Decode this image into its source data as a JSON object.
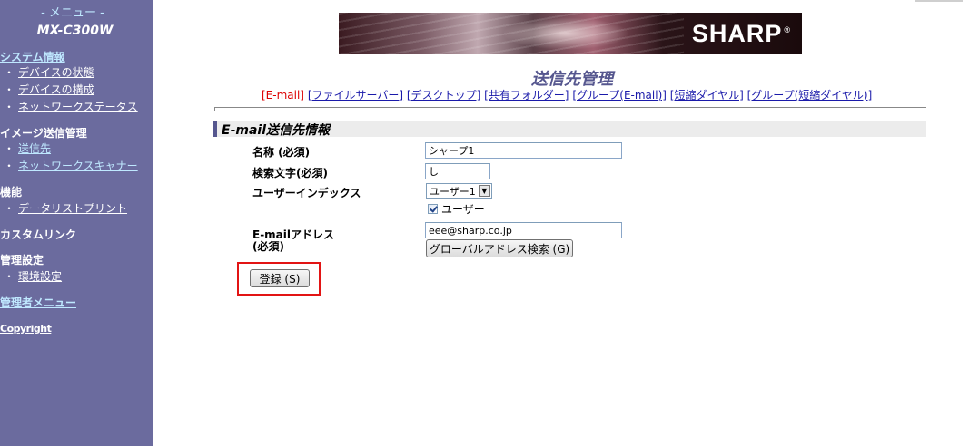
{
  "sidebar": {
    "menu_title": "- メニュー -",
    "model": "MX-C300W",
    "sections": [
      {
        "title": "システム情報",
        "items": [
          "デバイスの状態",
          "デバイスの構成",
          "ネットワークステータス"
        ]
      },
      {
        "title": "イメージ送信管理",
        "items": [
          "送信先",
          "ネットワークスキャナー"
        ]
      },
      {
        "title": "機能",
        "items": [
          "データリストプリント"
        ]
      },
      {
        "title": "カスタムリンク",
        "items": []
      },
      {
        "title": "管理設定",
        "items": [
          "環境設定"
        ]
      }
    ],
    "admin_menu": "管理者メニュー",
    "copyright": "Copyright"
  },
  "banner": {
    "brand": "SHARP",
    "reg": "®"
  },
  "page_title": "送信先管理",
  "tabs": [
    {
      "label": "[E-mail]",
      "active": true
    },
    {
      "label": "[ファイルサーバー]",
      "active": false
    },
    {
      "label": "[デスクトップ]",
      "active": false
    },
    {
      "label": "[共有フォルダー]",
      "active": false
    },
    {
      "label": "[グループ(E-mail)]",
      "active": false
    },
    {
      "label": "[短縮ダイヤル]",
      "active": false
    },
    {
      "label": "[グループ(短縮ダイヤル)]",
      "active": false
    }
  ],
  "section_title": "E-mail送信先情報",
  "form": {
    "name_label": "名称 (必須)",
    "name_value": "シャープ1",
    "search_label": "検索文字(必須)",
    "search_value": "し",
    "index_label": "ユーザーインデックス",
    "index_value": "ユーザー1",
    "user_checkbox_label": "ユーザー",
    "user_checkbox_checked": true,
    "email_label_line1": "E-mailアドレス",
    "email_label_line2": "(必須)",
    "email_value": "eee@sharp.co.jp",
    "global_search_button": "グローバルアドレス検索 (G)",
    "register_button": "登録 (S)"
  },
  "colors": {
    "sidebar_bg": "#6b6b9e",
    "accent": "#55568e",
    "active_tab": "#dd0000",
    "link": "#1a1aaa",
    "highlight": "#e21414"
  }
}
